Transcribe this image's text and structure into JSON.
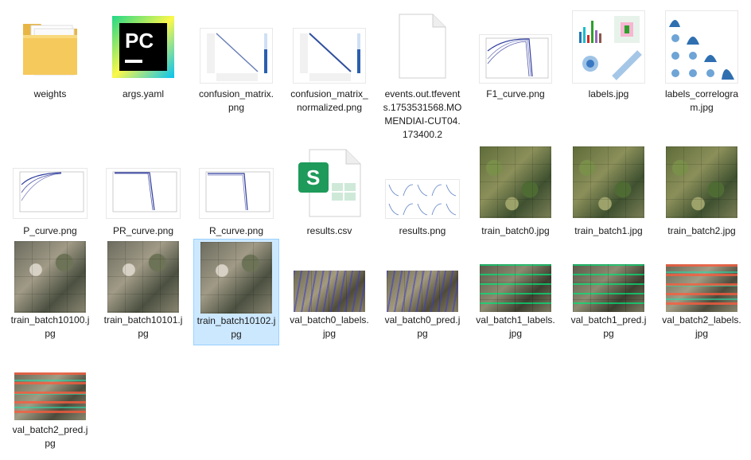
{
  "files": [
    {
      "name": "weights",
      "kind": "folder"
    },
    {
      "name": "args.yaml",
      "kind": "pycharm"
    },
    {
      "name": "confusion_matrix.png",
      "kind": "matrix"
    },
    {
      "name": "confusion_matrix_normalized.png",
      "kind": "matrix"
    },
    {
      "name": "events.out.tfevents.1753531568.MOMENDIAI-CUT04.173400.2",
      "kind": "blank"
    },
    {
      "name": "F1_curve.png",
      "kind": "curve"
    },
    {
      "name": "labels.jpg",
      "kind": "labels"
    },
    {
      "name": "labels_correlogram.jpg",
      "kind": "correlogram"
    },
    {
      "name": "P_curve.png",
      "kind": "curve"
    },
    {
      "name": "PR_curve.png",
      "kind": "curve"
    },
    {
      "name": "R_curve.png",
      "kind": "curve"
    },
    {
      "name": "results.csv",
      "kind": "spreadsheet",
      "icon_letter": "S"
    },
    {
      "name": "results.png",
      "kind": "results"
    },
    {
      "name": "train_batch0.jpg",
      "kind": "photo"
    },
    {
      "name": "train_batch1.jpg",
      "kind": "photo"
    },
    {
      "name": "train_batch2.jpg",
      "kind": "photo"
    },
    {
      "name": "train_batch10100.jpg",
      "kind": "photo-gray"
    },
    {
      "name": "train_batch10101.jpg",
      "kind": "photo-gray"
    },
    {
      "name": "train_batch10102.jpg",
      "kind": "photo-gray",
      "selected": true
    },
    {
      "name": "val_batch0_labels.jpg",
      "kind": "photo-val"
    },
    {
      "name": "val_batch0_pred.jpg",
      "kind": "photo-val"
    },
    {
      "name": "val_batch1_labels.jpg",
      "kind": "photo-valg"
    },
    {
      "name": "val_batch1_pred.jpg",
      "kind": "photo-valg"
    },
    {
      "name": "val_batch2_labels.jpg",
      "kind": "photo-valr"
    },
    {
      "name": "val_batch2_pred.jpg",
      "kind": "photo-valr"
    }
  ],
  "pycharm_letters": "PC",
  "colors": {
    "selection_bg": "#cce8ff",
    "folder": "#f5c95c",
    "pycharm_green": "#21d789",
    "spreadsheet_green": "#1e9a5a"
  }
}
